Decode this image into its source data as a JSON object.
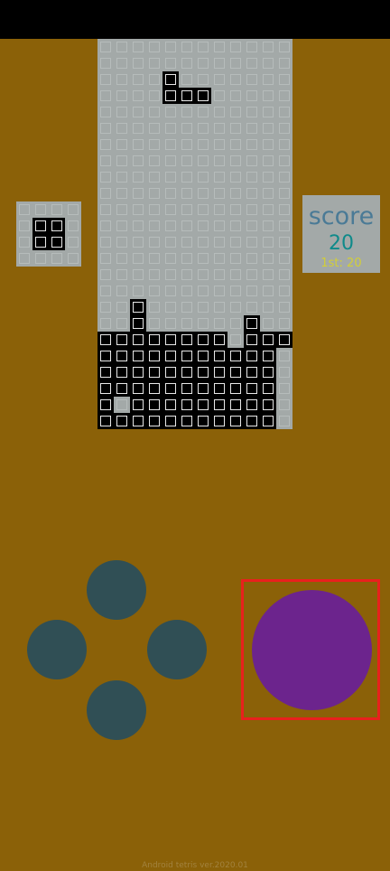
{
  "board": {
    "cols": 12,
    "rows": 24,
    "filled_cells": [
      [
        4,
        2
      ],
      [
        4,
        3
      ],
      [
        5,
        3
      ],
      [
        6,
        3
      ],
      [
        2,
        16
      ],
      [
        2,
        17
      ],
      [
        9,
        17
      ],
      [
        0,
        18
      ],
      [
        1,
        18
      ],
      [
        2,
        18
      ],
      [
        3,
        18
      ],
      [
        4,
        18
      ],
      [
        5,
        18
      ],
      [
        6,
        18
      ],
      [
        7,
        18
      ],
      [
        9,
        18
      ],
      [
        10,
        18
      ],
      [
        11,
        18
      ],
      [
        0,
        19
      ],
      [
        1,
        19
      ],
      [
        2,
        19
      ],
      [
        3,
        19
      ],
      [
        4,
        19
      ],
      [
        5,
        19
      ],
      [
        6,
        19
      ],
      [
        7,
        19
      ],
      [
        8,
        19
      ],
      [
        9,
        19
      ],
      [
        10,
        19
      ],
      [
        0,
        20
      ],
      [
        1,
        20
      ],
      [
        2,
        20
      ],
      [
        3,
        20
      ],
      [
        4,
        20
      ],
      [
        5,
        20
      ],
      [
        6,
        20
      ],
      [
        7,
        20
      ],
      [
        8,
        20
      ],
      [
        9,
        20
      ],
      [
        10,
        20
      ],
      [
        0,
        21
      ],
      [
        1,
        21
      ],
      [
        2,
        21
      ],
      [
        3,
        21
      ],
      [
        4,
        21
      ],
      [
        5,
        21
      ],
      [
        6,
        21
      ],
      [
        7,
        21
      ],
      [
        8,
        21
      ],
      [
        9,
        21
      ],
      [
        10,
        21
      ],
      [
        0,
        22
      ],
      [
        2,
        22
      ],
      [
        3,
        22
      ],
      [
        4,
        22
      ],
      [
        5,
        22
      ],
      [
        6,
        22
      ],
      [
        7,
        22
      ],
      [
        8,
        22
      ],
      [
        9,
        22
      ],
      [
        10,
        22
      ],
      [
        0,
        23
      ],
      [
        1,
        23
      ],
      [
        2,
        23
      ],
      [
        3,
        23
      ],
      [
        4,
        23
      ],
      [
        5,
        23
      ],
      [
        6,
        23
      ],
      [
        7,
        23
      ],
      [
        8,
        23
      ],
      [
        9,
        23
      ],
      [
        10,
        23
      ]
    ]
  },
  "next_piece": {
    "cols": 4,
    "rows": 4,
    "filled_cells": [
      [
        1,
        1
      ],
      [
        2,
        1
      ],
      [
        1,
        2
      ],
      [
        2,
        2
      ]
    ]
  },
  "score": {
    "title": "score",
    "value": "20",
    "best": "1st: 20"
  },
  "controls": {
    "dpad_color": "#304f55",
    "action_color": "#6c248d",
    "highlight_color": "#e8211d"
  },
  "footer": {
    "text": "Android tetris ver.2020.01"
  },
  "colors": {
    "background": "#8B6108",
    "board_empty": "#a3a9a8",
    "cell_filled": "#000000"
  }
}
